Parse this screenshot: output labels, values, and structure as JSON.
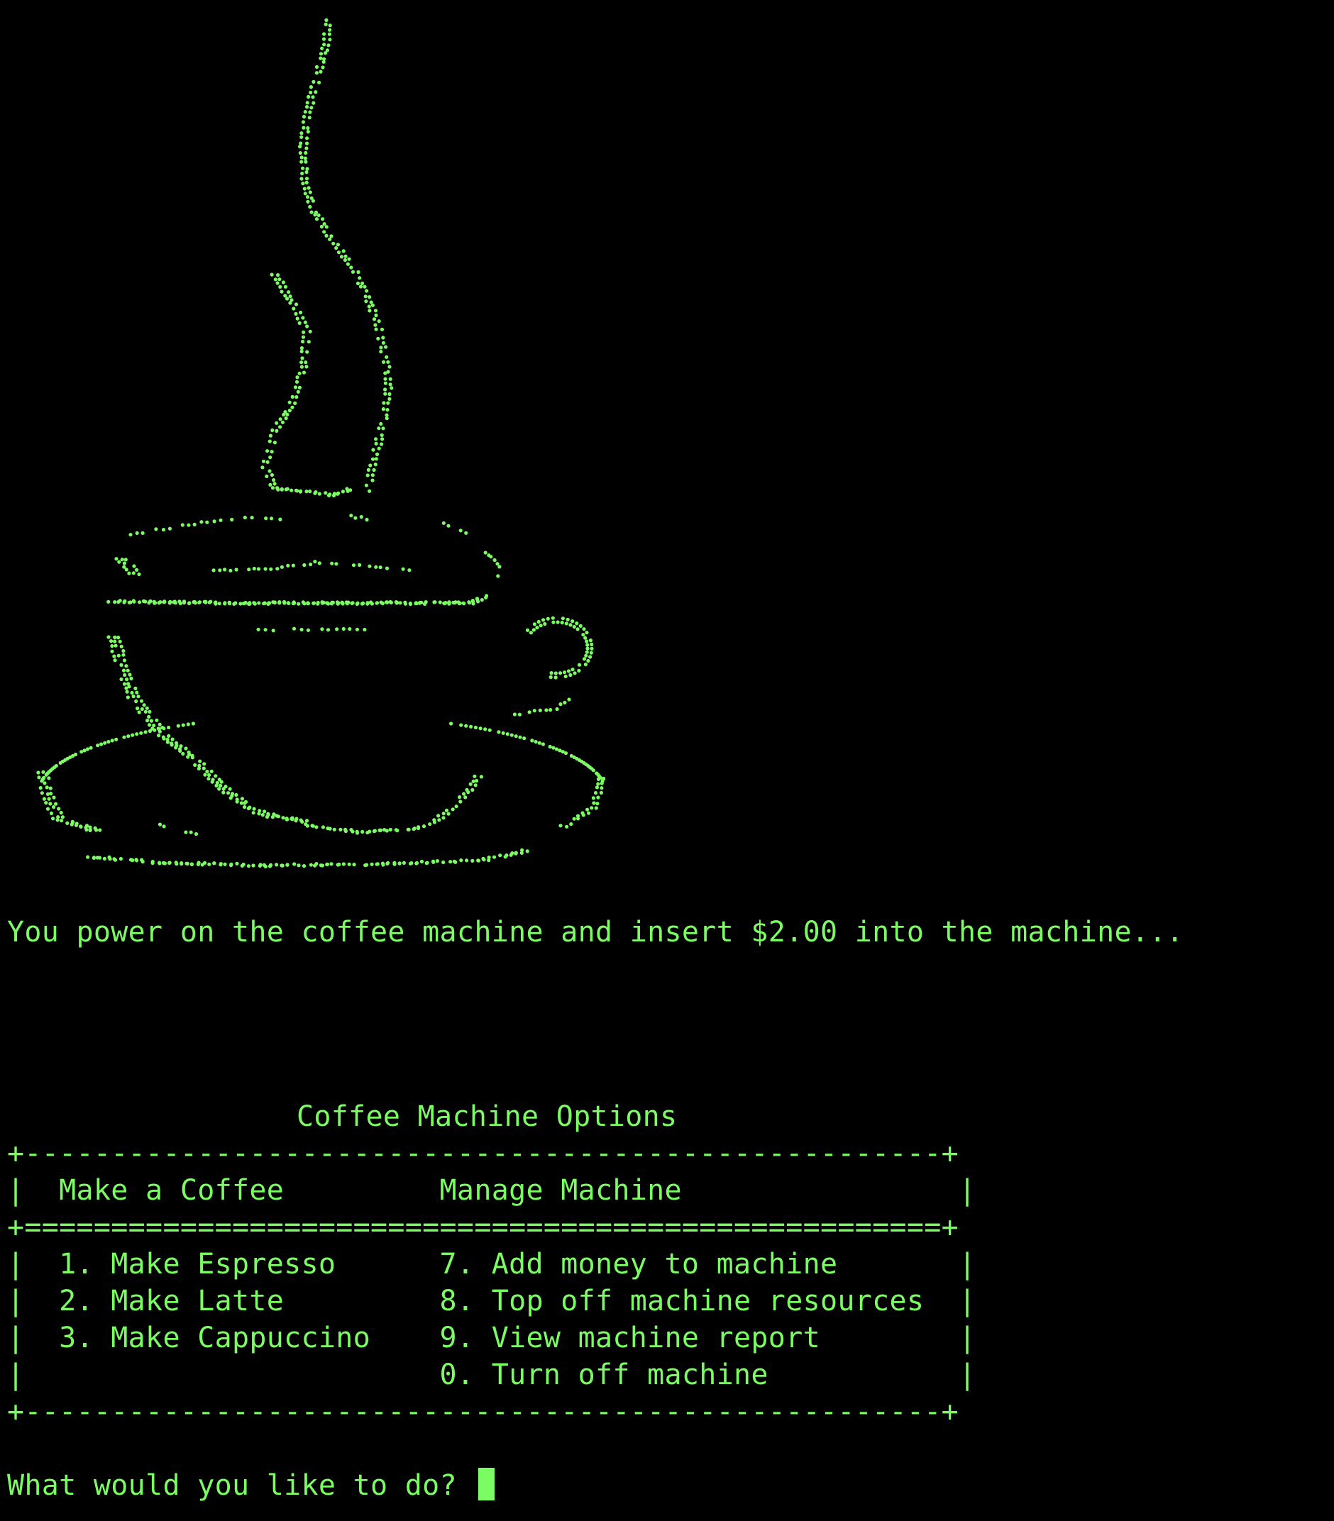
{
  "colors": {
    "background": "#000000",
    "foreground": "#7CFC63"
  },
  "art": {
    "icon": "coffee-cup-braille-art"
  },
  "intro_message": "You power on the coffee machine and insert $2.00 into the machine...",
  "menu": {
    "title": "Coffee Machine Options",
    "border_top": "+-----------------------------------------------------+",
    "header_row": "|  Make a Coffee         Manage Machine                |",
    "header_separator": "+=====================================================+",
    "rows": [
      "|  1. Make Espresso      7. Add money to machine       |",
      "|  2. Make Latte         8. Top off machine resources  |",
      "|  3. Make Cappuccino    9. View machine report        |",
      "|                        0. Turn off machine           |"
    ],
    "border_bottom": "+-----------------------------------------------------+"
  },
  "prompt": {
    "text": "What would you like to do? "
  }
}
